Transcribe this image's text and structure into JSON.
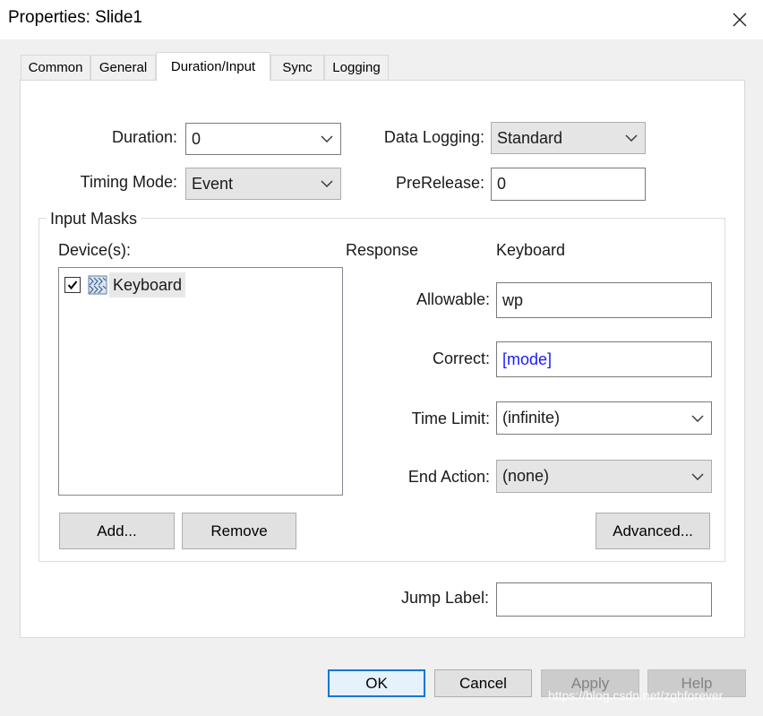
{
  "window": {
    "title": "Properties: Slide1",
    "close_icon": "close-icon"
  },
  "tabs": [
    {
      "label": "Common",
      "active": false
    },
    {
      "label": "General",
      "active": false
    },
    {
      "label": "Duration/Input",
      "active": true
    },
    {
      "label": "Sync",
      "active": false
    },
    {
      "label": "Logging",
      "active": false
    }
  ],
  "duration": {
    "label": "Duration:",
    "value": "0"
  },
  "timing_mode": {
    "label": "Timing Mode:",
    "value": "Event"
  },
  "data_logging": {
    "label": "Data Logging:",
    "value": "Standard"
  },
  "prerelease": {
    "label": "PreRelease:",
    "value": "0"
  },
  "input_masks": {
    "legend": "Input Masks",
    "devices_label": "Device(s):",
    "devices": [
      {
        "label": "Keyboard",
        "checked": true,
        "icon": "keyboard-icon"
      }
    ],
    "response_header": "Response",
    "device_header": "Keyboard",
    "allowable": {
      "label": "Allowable:",
      "value": "wp"
    },
    "correct": {
      "label": "Correct:",
      "value": "[mode]",
      "color": "#0000ff"
    },
    "time_limit": {
      "label": "Time Limit:",
      "value": "(infinite)"
    },
    "end_action": {
      "label": "End Action:",
      "value": "(none)"
    },
    "add_button": "Add...",
    "remove_button": "Remove",
    "advanced_button": "Advanced..."
  },
  "jump_label": {
    "label": "Jump Label:",
    "value": ""
  },
  "footer": {
    "ok": "OK",
    "cancel": "Cancel",
    "apply": "Apply",
    "help": "Help"
  },
  "watermark": "https://blog.csdn.net/zghforever",
  "colors": {
    "accent": "#0078d7",
    "dialog_bg": "#f0f0f0",
    "panel_bg": "#ffffff"
  }
}
